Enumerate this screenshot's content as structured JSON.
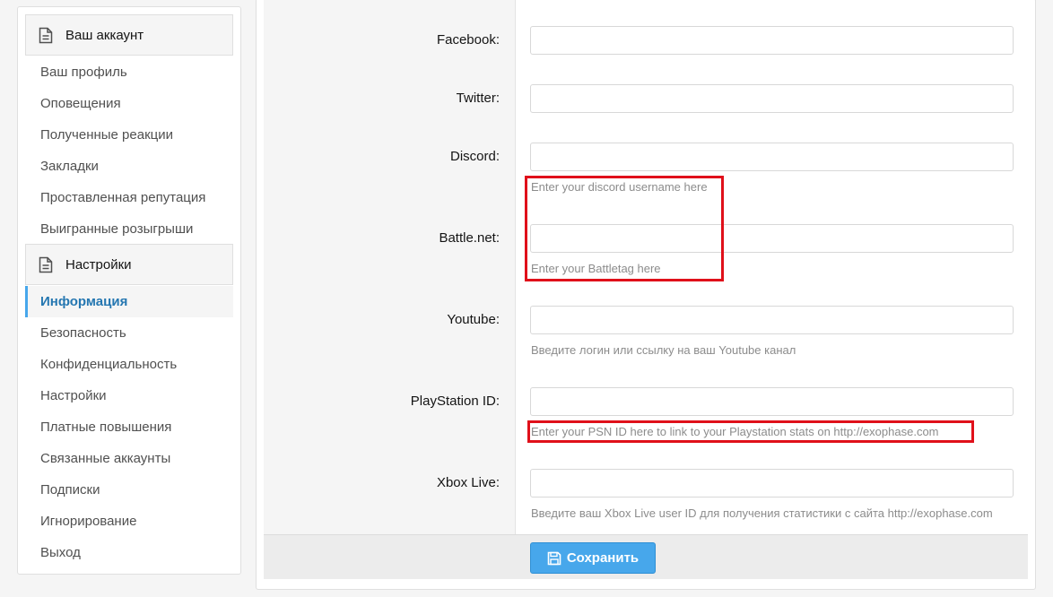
{
  "sidebar": {
    "account_header": "Ваш аккаунт",
    "account_items": [
      {
        "label": "Ваш профиль"
      },
      {
        "label": "Оповещения"
      },
      {
        "label": "Полученные реакции"
      },
      {
        "label": "Закладки"
      },
      {
        "label": "Проставленная репутация"
      },
      {
        "label": "Выигранные розыгрыши"
      }
    ],
    "settings_header": "Настройки",
    "settings_items": [
      {
        "label": "Информация",
        "active": true
      },
      {
        "label": "Безопасность"
      },
      {
        "label": "Конфиденциальность"
      },
      {
        "label": "Настройки"
      },
      {
        "label": "Платные повышения"
      },
      {
        "label": "Связанные аккаунты"
      },
      {
        "label": "Подписки"
      },
      {
        "label": "Игнорирование"
      },
      {
        "label": "Выход"
      }
    ]
  },
  "form": {
    "fields": [
      {
        "label": "Facebook:",
        "value": "",
        "hint": ""
      },
      {
        "label": "Twitter:",
        "value": "",
        "hint": ""
      },
      {
        "label": "Discord:",
        "value": "",
        "hint": "Enter your discord username here"
      },
      {
        "label": "Battle.net:",
        "value": "",
        "hint": "Enter your Battletag here"
      },
      {
        "label": "Youtube:",
        "value": "",
        "hint": "Введите логин или ссылку на ваш Youtube канал"
      },
      {
        "label": "PlayStation ID:",
        "value": "",
        "hint": "Enter your PSN ID here to link to your Playstation stats on http://exophase.com"
      },
      {
        "label": "Xbox Live:",
        "value": "",
        "hint": "Введите ваш Xbox Live user ID для получения статистики с сайта http://exophase.com"
      }
    ],
    "save_label": "Сохранить"
  },
  "colors": {
    "accent": "#47a7eb",
    "active_text": "#2577b1",
    "highlight": "#e0101a"
  }
}
